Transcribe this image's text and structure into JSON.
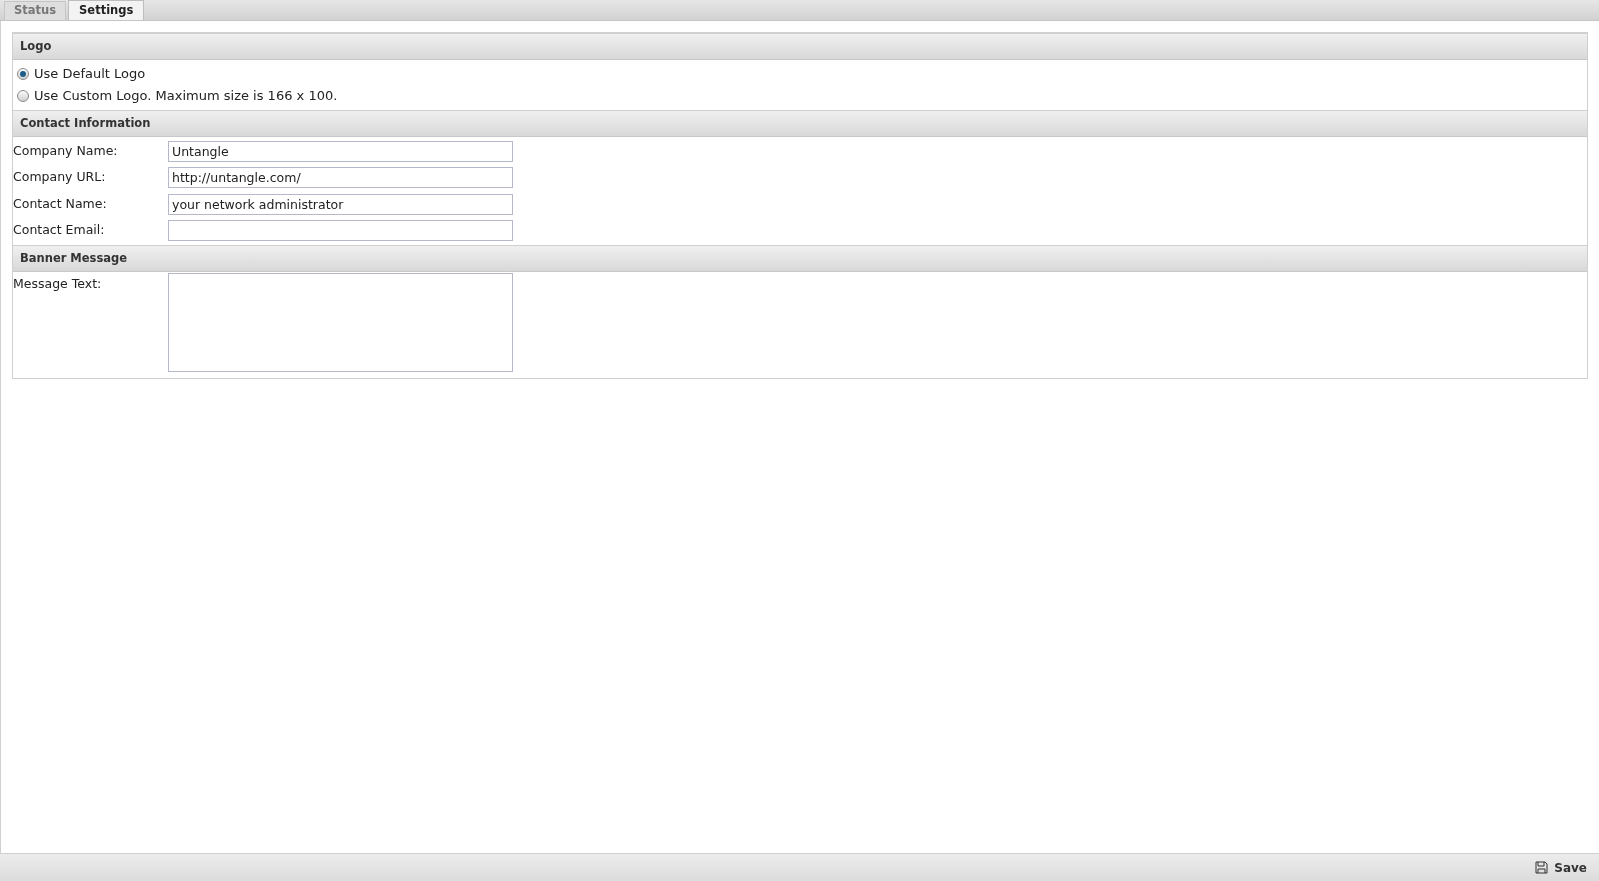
{
  "tabs": [
    {
      "label": "Status",
      "selected": false
    },
    {
      "label": "Settings",
      "selected": true
    }
  ],
  "sections": [
    {
      "title": "Logo",
      "kind": "radios",
      "options": [
        {
          "label": "Use Default Logo",
          "selected": true
        },
        {
          "label": "Use Custom Logo. Maximum size is 166 x 100.",
          "selected": false
        }
      ]
    },
    {
      "title": "Contact Information",
      "kind": "fields",
      "fields": [
        {
          "label": "Company Name:",
          "value": "Untangle"
        },
        {
          "label": "Company URL:",
          "value": "http://untangle.com/"
        },
        {
          "label": "Contact Name:",
          "value": "your network administrator"
        },
        {
          "label": "Contact Email:"
        }
      ]
    },
    {
      "title": "Banner Message",
      "kind": "textarea",
      "fields": [
        {
          "label": "Message Text:"
        }
      ]
    }
  ],
  "footer": {
    "save": "Save"
  }
}
